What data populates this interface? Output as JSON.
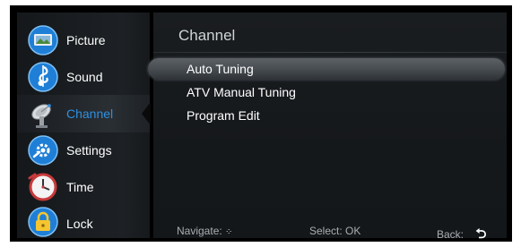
{
  "sidebar": {
    "items": [
      {
        "label": "Picture",
        "icon": "picture-icon"
      },
      {
        "label": "Sound",
        "icon": "sound-icon"
      },
      {
        "label": "Channel",
        "icon": "channel-icon",
        "active": true
      },
      {
        "label": "Settings",
        "icon": "settings-icon"
      },
      {
        "label": "Time",
        "icon": "time-icon"
      },
      {
        "label": "Lock",
        "icon": "lock-icon"
      }
    ]
  },
  "main": {
    "title": "Channel",
    "menu": [
      {
        "label": "Auto Tuning",
        "selected": true
      },
      {
        "label": "ATV Manual Tuning"
      },
      {
        "label": "Program Edit"
      }
    ]
  },
  "footer": {
    "navigate_label": "Navigate:",
    "navigate_glyph": "⁘",
    "select_label": "Select: OK",
    "back_label": "Back:",
    "back_glyph": "⮌"
  },
  "colors": {
    "background": "#000000",
    "active_text": "#2f8fe0",
    "text": "#ffffff",
    "icon_blue": "#1f7fd6"
  }
}
